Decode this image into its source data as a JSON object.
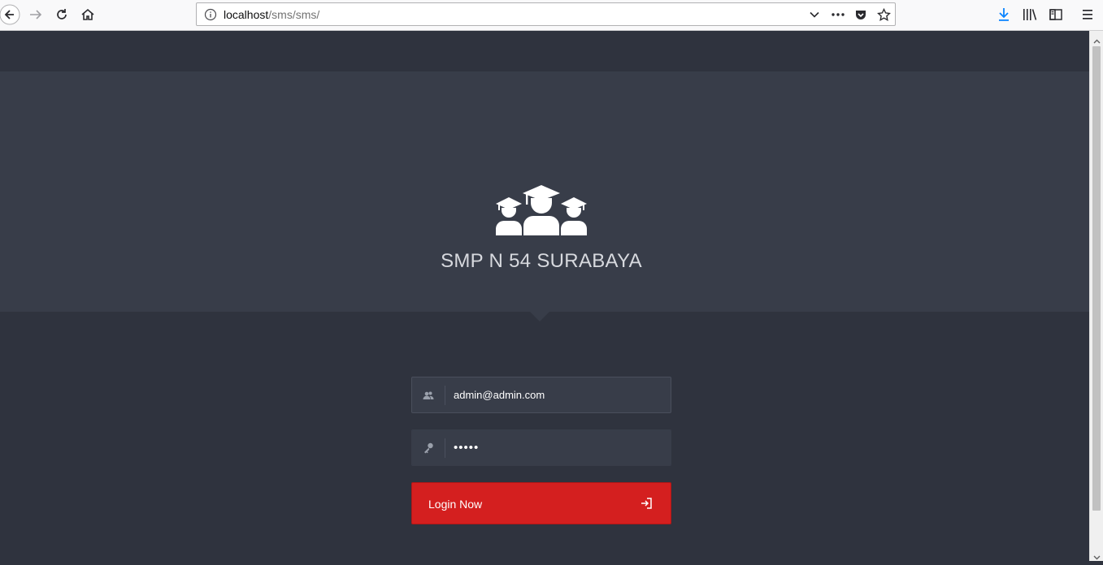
{
  "browser": {
    "url_host": "localhost",
    "url_path": "/sms/sms/",
    "icons": [
      "back-icon",
      "forward-icon",
      "reload-icon",
      "home-icon",
      "info-icon",
      "dropdown-icon",
      "more-icon",
      "pocket-icon",
      "bookmark-star-icon",
      "download-icon",
      "library-icon",
      "sidebar-icon",
      "menu-icon"
    ]
  },
  "page": {
    "logo_icon": "graduates-icon",
    "school_name": "SMP N 54 SURABAYA"
  },
  "login": {
    "email_value": "admin@admin.com",
    "password_masked": "•••••",
    "button_label": "Login Now",
    "button_icon": "login-arrow-icon",
    "accent_color": "#d41f1f"
  }
}
